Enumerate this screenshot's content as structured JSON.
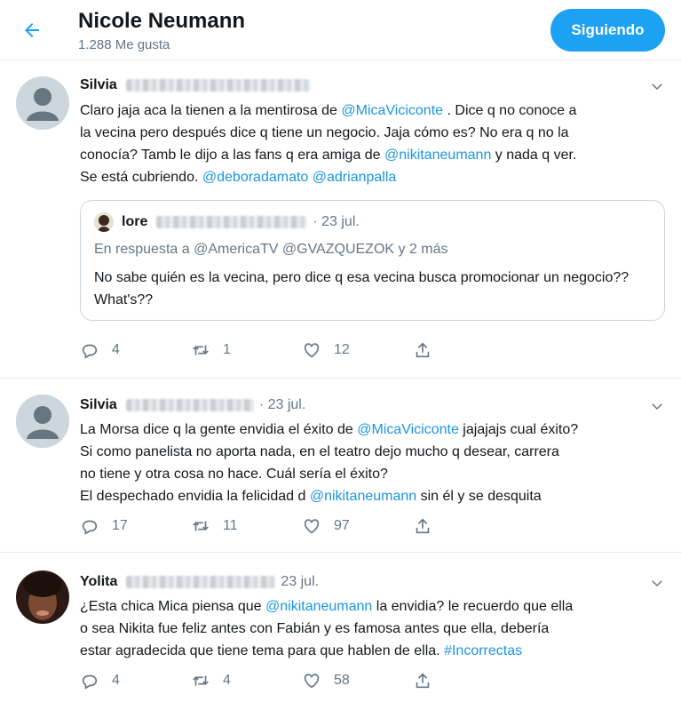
{
  "header": {
    "title": "Nicole Neumann",
    "likes": "1.288 Me gusta",
    "follow_label": "Siguiendo"
  },
  "tweets": [
    {
      "name": "Silvia",
      "date": "",
      "lines": [
        [
          {
            "t": "Claro jaja aca la tienen a la mentirosa de "
          },
          {
            "m": "@MicaViciconte"
          },
          {
            "t": " . Dice q no conoce a"
          }
        ],
        [
          {
            "t": "la vecina pero después dice q tiene un negocio. Jaja cómo es? No era q no la"
          }
        ],
        [
          {
            "t": "conocía? Tamb le dijo a las fans q era amiga de "
          },
          {
            "m": "@nikitaneumann"
          },
          {
            "t": " y nada q ver."
          }
        ],
        [
          {
            "t": "Se está cubriendo. "
          },
          {
            "m": "@deboradamato"
          },
          {
            "t": " "
          },
          {
            "m": "@adrianpalla"
          }
        ]
      ],
      "quote": {
        "name": "lore",
        "date": "· 23 jul.",
        "reply": "En respuesta a @AmericaTV @GVAZQUEZOK y 2 más",
        "text": "No sabe quién es la vecina, pero dice q esa vecina busca promocionar un negocio?? What's??"
      },
      "actions": {
        "replies": "4",
        "retweets": "1",
        "likes": "12"
      }
    },
    {
      "name": "Silvia",
      "date": "· 23 jul.",
      "lines": [
        [
          {
            "t": "La Morsa dice q la gente envidia el éxito de "
          },
          {
            "m": "@MicaViciconte"
          },
          {
            "t": " jajajajs cual éxito?"
          }
        ],
        [
          {
            "t": "Si como panelista no aporta nada, en el teatro dejo mucho q desear, carrera"
          }
        ],
        [
          {
            "t": "no tiene y otra cosa no hace. Cuál sería el éxito?"
          }
        ],
        [
          {
            "t": "El despechado envidia la felicidad d "
          },
          {
            "m": "@nikitaneumann"
          },
          {
            "t": " sin él y se desquita"
          }
        ]
      ],
      "actions": {
        "replies": "17",
        "retweets": "11",
        "likes": "97"
      }
    },
    {
      "name": "Yolita",
      "date": "23 jul.",
      "lines": [
        [
          {
            "t": "¿Esta chica Mica piensa que "
          },
          {
            "m": "@nikitaneumann"
          },
          {
            "t": " la envidia? le recuerdo que ella"
          }
        ],
        [
          {
            "t": "o sea Nikita fue feliz antes con Fabián y es famosa antes que ella, debería"
          }
        ],
        [
          {
            "t": "estar agradecida que tiene tema para que hablen de ella. "
          },
          {
            "m": "#Incorrectas"
          }
        ]
      ],
      "actions": {
        "replies": "4",
        "retweets": "4",
        "likes": "58"
      }
    }
  ],
  "colors": {
    "accent": "#1da1f2",
    "mention": "#1b95e0",
    "muted": "#657786",
    "border": "#e6ecf0"
  },
  "icons": [
    "back-arrow-icon",
    "chevron-down-icon",
    "reply-icon",
    "retweet-icon",
    "like-icon",
    "share-icon"
  ]
}
